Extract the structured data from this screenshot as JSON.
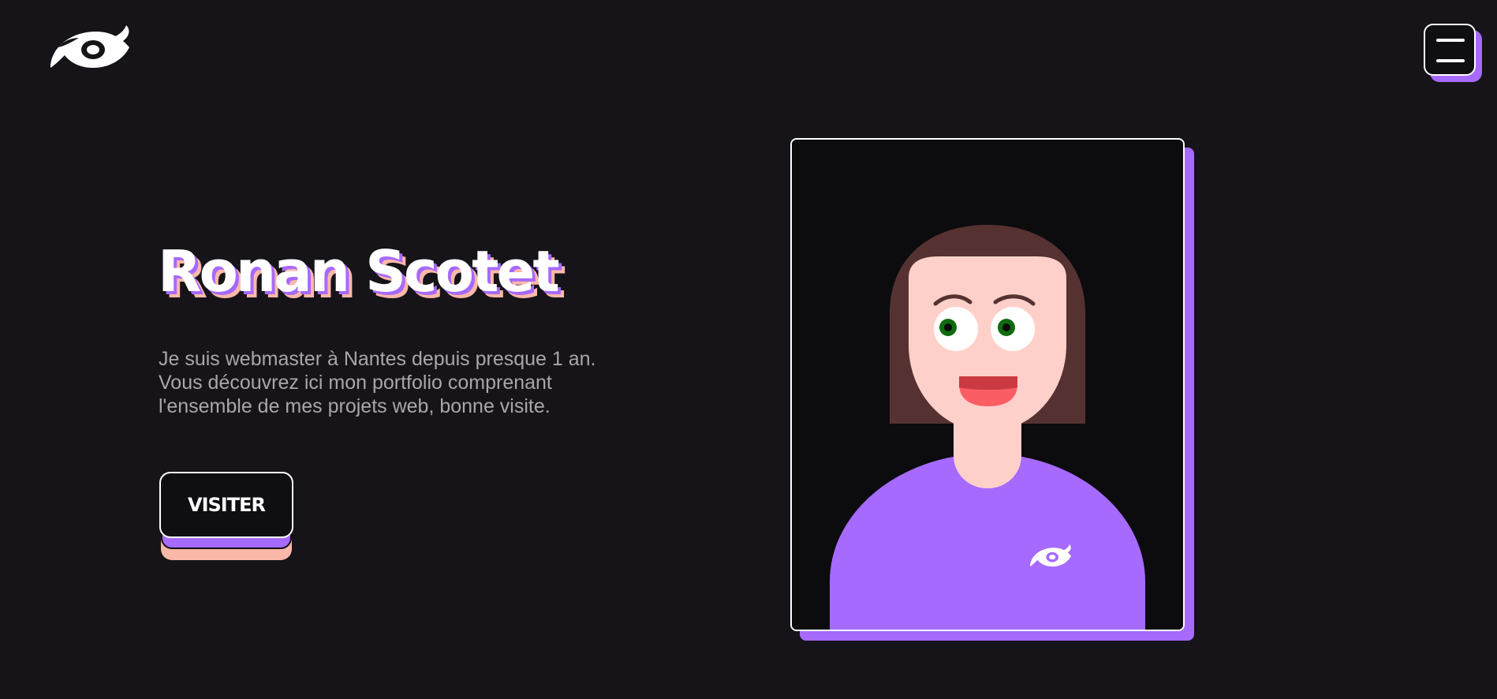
{
  "header": {
    "logo_icon": "swirl-logo-icon",
    "menu_icon": "hamburger-menu-icon"
  },
  "hero": {
    "name": "Ronan Scotet",
    "description": "Je suis webmaster à Nantes depuis presque 1 an. Vous découvrez ici mon portfolio comprenant l'ensemble de mes projets web, bonne visite.",
    "cta_label": "VISITER"
  },
  "portrait": {
    "illustration": "avatar-illustration",
    "shirt_logo_icon": "swirl-logo-icon"
  },
  "colors": {
    "background": "#161418",
    "accent_purple": "#a66afe",
    "accent_peach": "#fcb8a8",
    "hair": "#553231",
    "skin": "#ffd0c9",
    "eye_iris": "#0f6b0f",
    "mouth": "#fa5d63"
  }
}
